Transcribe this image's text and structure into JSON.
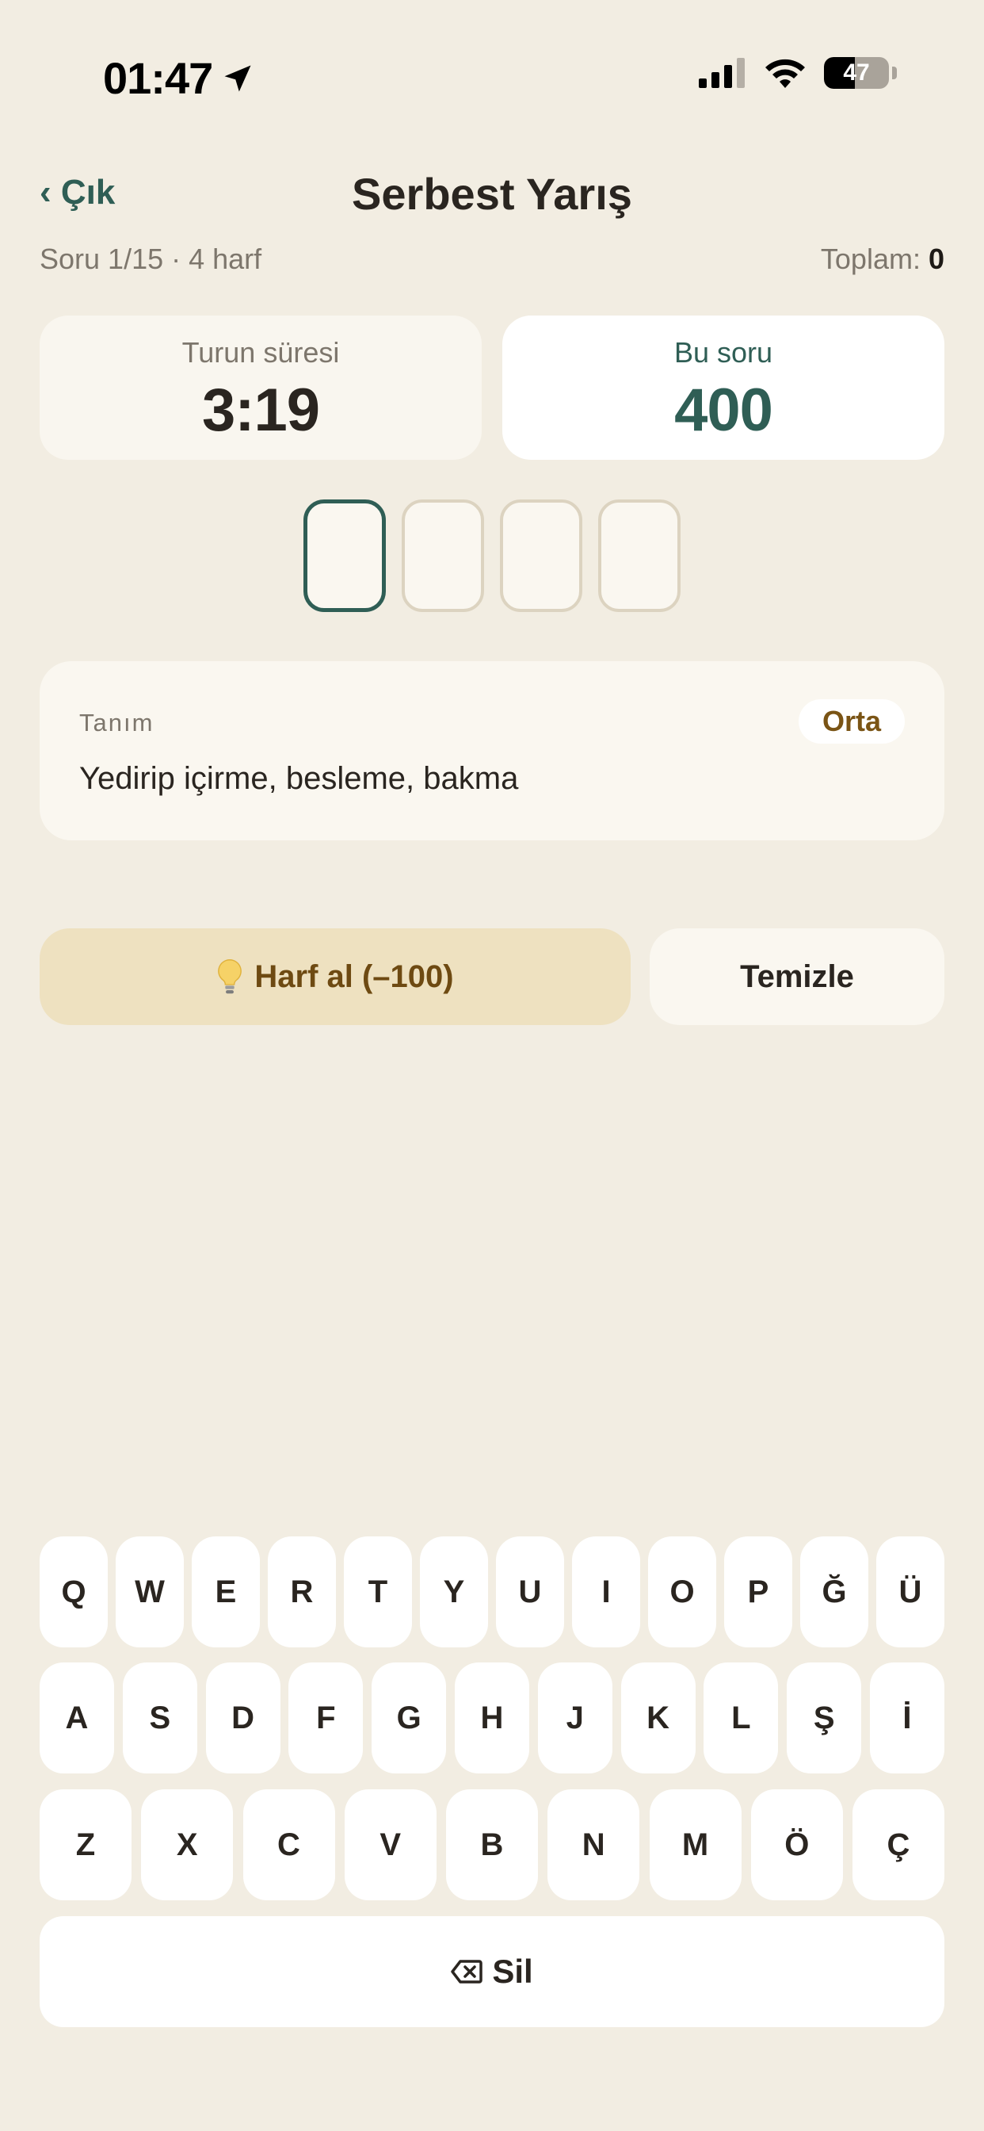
{
  "status_bar": {
    "time": "01:47",
    "location_icon": "location-arrow-icon",
    "signal_icon": "cellular-signal-icon",
    "wifi_icon": "wifi-icon",
    "battery_level": "47",
    "battery_fraction": 0.47
  },
  "header": {
    "back_label": "‹ Çık",
    "title": "Serbest Yarış",
    "progress_text": "Soru 1/15 · 4 harf",
    "total_label": "Toplam: ",
    "total_value": "0"
  },
  "stats": {
    "timer_label": "Turun süresi",
    "timer_value": "3:19",
    "score_label": "Bu soru",
    "score_value": "400"
  },
  "answer": {
    "letter_count": 4,
    "active_slot": 0,
    "letters": [
      "",
      "",
      "",
      ""
    ]
  },
  "definition": {
    "label": "Tanım",
    "difficulty": "Orta",
    "text": "Yedirip içirme, besleme, bakma"
  },
  "actions": {
    "hint_icon": "lightbulb-icon",
    "hint_label": "Harf al (–100)",
    "clear_label": "Temizle"
  },
  "keyboard": {
    "row1": [
      "Q",
      "W",
      "E",
      "R",
      "T",
      "Y",
      "U",
      "I",
      "O",
      "P",
      "Ğ",
      "Ü"
    ],
    "row2": [
      "A",
      "S",
      "D",
      "F",
      "G",
      "H",
      "J",
      "K",
      "L",
      "Ş",
      "İ"
    ],
    "row3": [
      "Z",
      "X",
      "C",
      "V",
      "B",
      "N",
      "M",
      "Ö",
      "Ç"
    ],
    "delete_icon": "backspace-icon",
    "delete_label": "Sil"
  },
  "colors": {
    "background": "#F2EDE2",
    "accent_green": "#2F5E55",
    "hint_bg": "#EEE1C0",
    "hint_text": "#6E4A12"
  }
}
